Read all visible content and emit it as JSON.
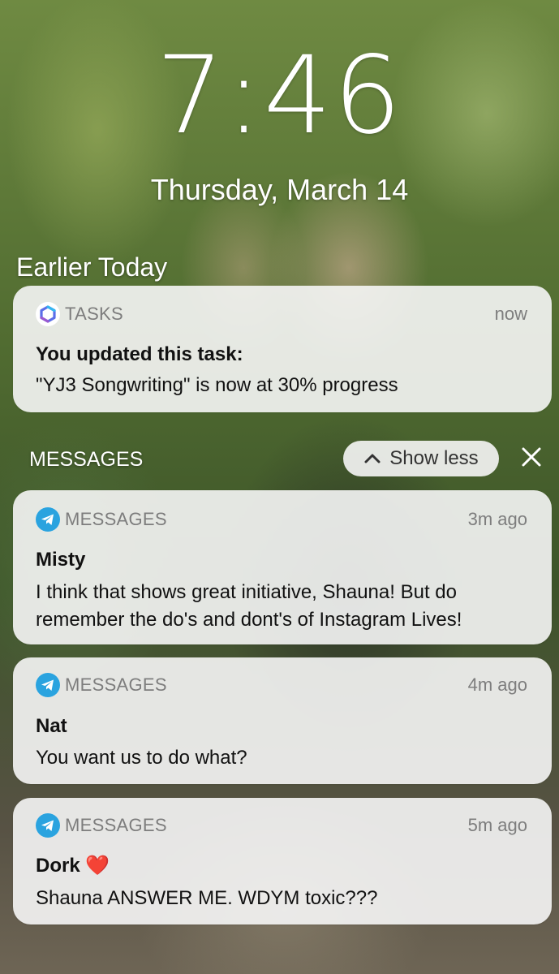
{
  "lockscreen": {
    "time": "7:46",
    "date": "Thursday, March 14",
    "section_title": "Earlier Today"
  },
  "tasks_notification": {
    "app_name": "TASKS",
    "time": "now",
    "title": "You updated this task:",
    "body": "\"YJ3 Songwriting\" is now at 30% progress",
    "icon": "microsoft-todo-icon"
  },
  "messages_group": {
    "label": "MESSAGES",
    "show_less_label": "Show less",
    "chevron_icon": "chevron-up-icon",
    "close_icon": "close-icon",
    "notifications": [
      {
        "app_name": "MESSAGES",
        "time": "3m ago",
        "sender": "Misty",
        "body": "I think that shows great initiative, Shauna! But do remember the do's and dont's of Instagram Lives!",
        "icon": "telegram-icon"
      },
      {
        "app_name": "MESSAGES",
        "time": "4m ago",
        "sender": "Nat",
        "body": "You want us to do what?",
        "icon": "telegram-icon"
      },
      {
        "app_name": "MESSAGES",
        "time": "5m ago",
        "sender": "Dork ❤️",
        "body": "Shauna ANSWER ME. WDYM toxic???",
        "icon": "telegram-icon"
      }
    ]
  },
  "colors": {
    "telegram_blue": "#2aa3df",
    "card_bg": "#f6f6f6",
    "secondary_text": "#7d7d7d"
  }
}
